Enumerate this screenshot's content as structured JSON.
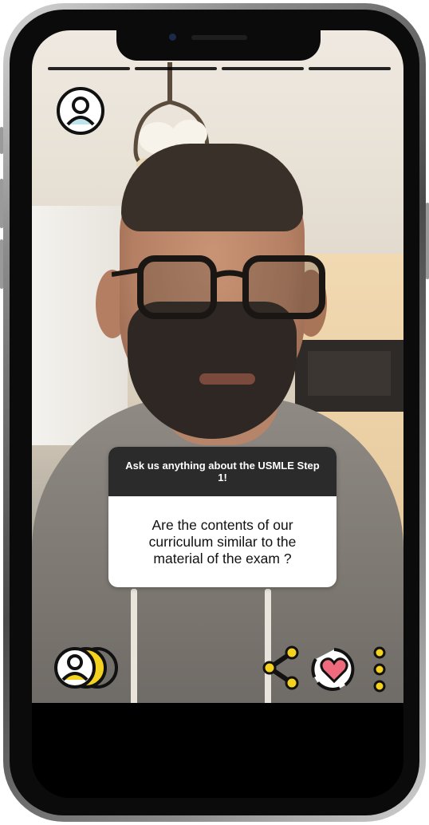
{
  "story": {
    "progress_segments": 4,
    "question_card": {
      "prompt": "Ask us anything about the USMLE Step 1!",
      "answer": "Are the contents of our curriculum similar to the material of the exam ?"
    }
  },
  "icons": {
    "profile": "profile-icon",
    "viewers": "viewers-icon",
    "share": "share-icon",
    "like": "heart-like-icon",
    "more": "more-options-icon"
  },
  "colors": {
    "accent": "#f5d21f",
    "heart": "#f06a7e",
    "card_header": "#2b2b2b"
  }
}
